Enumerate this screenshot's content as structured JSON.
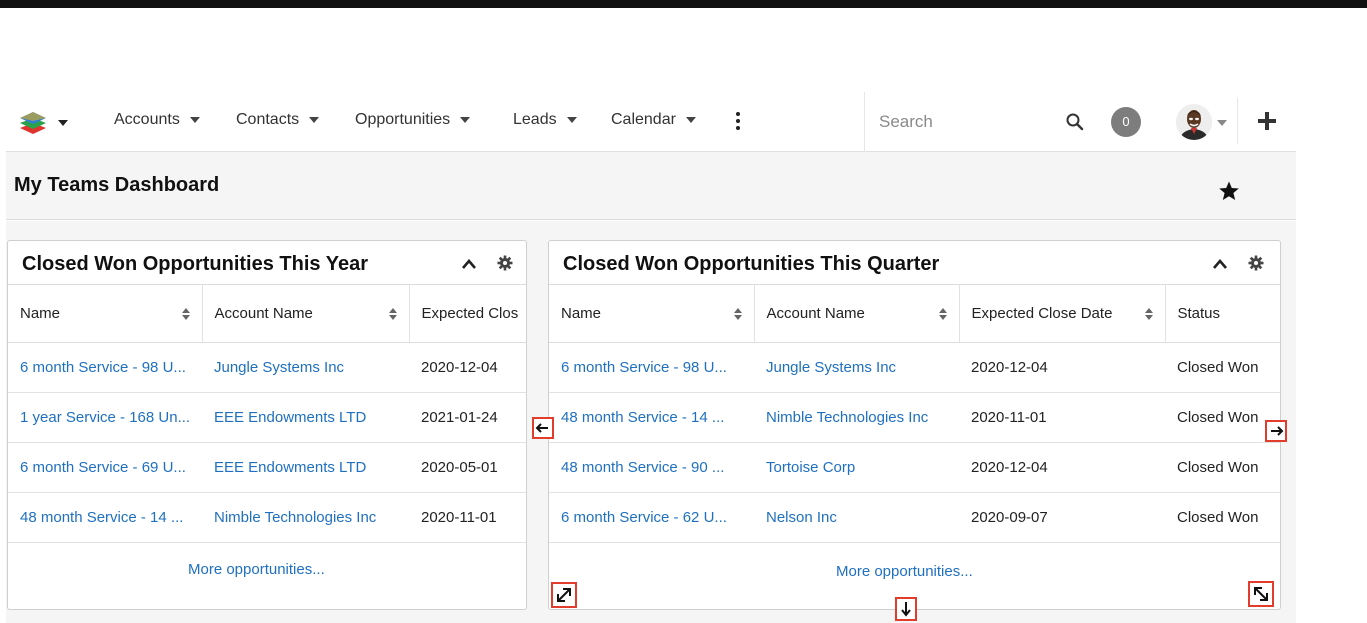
{
  "nav": {
    "menus": [
      {
        "label": "Accounts"
      },
      {
        "label": "Contacts"
      },
      {
        "label": "Opportunities"
      },
      {
        "label": "Leads"
      },
      {
        "label": "Calendar"
      }
    ],
    "search_placeholder": "Search",
    "notifications_count": "0"
  },
  "dashboard": {
    "title": "My Teams Dashboard"
  },
  "dashlets": [
    {
      "title": "Closed Won Opportunities This Year",
      "columns": [
        "Name",
        "Account Name",
        "Expected Clos"
      ],
      "rows": [
        [
          "6 month Service - 98 U...",
          "Jungle Systems Inc",
          "2020-12-04"
        ],
        [
          "1 year Service - 168 Un...",
          "EEE Endowments LTD",
          "2021-01-24"
        ],
        [
          "6 month Service - 69 U...",
          "EEE Endowments LTD",
          "2020-05-01"
        ],
        [
          "48 month Service - 14 ...",
          "Nimble Technologies Inc",
          "2020-11-01"
        ]
      ],
      "more": "More opportunities..."
    },
    {
      "title": "Closed Won Opportunities This Quarter",
      "columns": [
        "Name",
        "Account Name",
        "Expected Close Date",
        "Status"
      ],
      "rows": [
        [
          "6 month Service - 98 U...",
          "Jungle Systems Inc",
          "2020-12-04",
          "Closed Won"
        ],
        [
          "48 month Service - 14 ...",
          "Nimble Technologies Inc",
          "2020-11-01",
          "Closed Won"
        ],
        [
          "48 month Service - 90 ...",
          "Tortoise Corp",
          "2020-12-04",
          "Closed Won"
        ],
        [
          "6 month Service - 62 U...",
          "Nelson Inc",
          "2020-09-07",
          "Closed Won"
        ]
      ],
      "more": "More opportunities..."
    }
  ],
  "colors": {
    "link": "#1f70c1",
    "highlight": "#e23c2c",
    "header_bg": "#f5f5f5"
  }
}
